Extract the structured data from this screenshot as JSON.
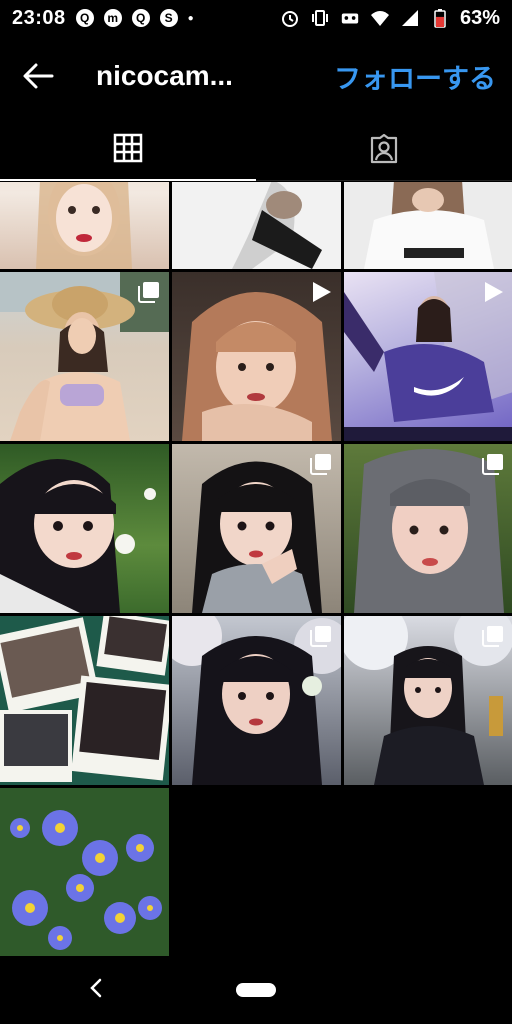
{
  "status_bar": {
    "time": "23:08",
    "app_badges": [
      "Q",
      "m",
      "Q",
      "S"
    ],
    "battery_percent": "63%",
    "battery_level": 0.63
  },
  "header": {
    "username": "nicocam...",
    "follow_label": "フォローする",
    "accent_color": "#3897f0"
  },
  "tabs": [
    {
      "icon": "grid-icon",
      "active": true
    },
    {
      "icon": "tagged-person-icon",
      "active": false
    }
  ],
  "grid": {
    "overlays": {
      "row1": [],
      "row2": [
        "carousel",
        "video",
        "video"
      ],
      "row3": [
        "none",
        "carousel",
        "carousel"
      ],
      "row4": [
        "none",
        "carousel",
        "carousel"
      ],
      "row5": [
        "none"
      ]
    }
  },
  "nav": {
    "back": "back-arrow",
    "home": "home-pill"
  }
}
